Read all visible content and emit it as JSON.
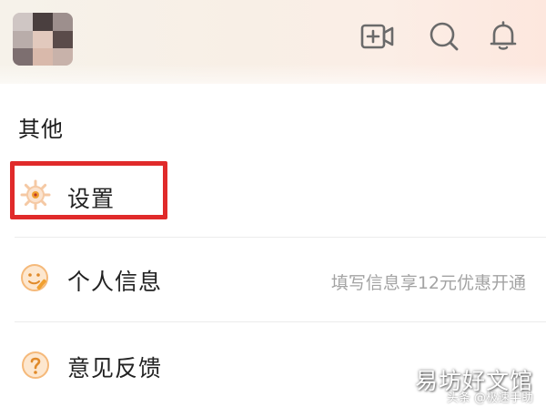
{
  "header": {
    "video_icon": "video-add-icon",
    "search_icon": "search-icon",
    "bell_icon": "bell-icon"
  },
  "section": {
    "title": "其他"
  },
  "menu": {
    "settings": {
      "label": "设置",
      "icon": "gear-icon"
    },
    "profile": {
      "label": "个人信息",
      "hint": "填写信息享12元优惠开通",
      "icon": "smiley-pen-icon"
    },
    "feedback": {
      "label": "意见反馈",
      "icon": "question-icon"
    }
  },
  "watermark": {
    "main": "易坊好文馆",
    "sub": "头条 @极速手助"
  },
  "colors": {
    "accent_orange": "#f0a030",
    "highlight_red": "#e02a2a",
    "icon_gray": "#6a6a6a",
    "hint_gray": "#a3a3a3"
  }
}
